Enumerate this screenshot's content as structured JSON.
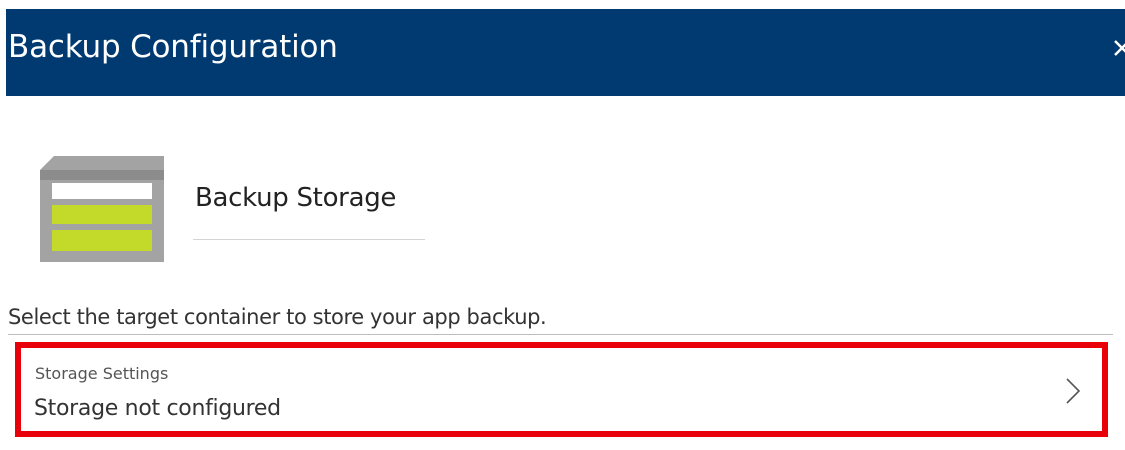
{
  "header": {
    "title": "Backup Configuration",
    "background_color": "#003a70",
    "close_icon": "close-icon"
  },
  "section": {
    "icon": "storage-icon",
    "title": "Backup Storage"
  },
  "description": "Select the target container to store your app backup.",
  "storage_settings": {
    "label": "Storage Settings",
    "value": "Storage not configured",
    "icon": "chevron-right-icon",
    "highlight_color": "#e8000b"
  }
}
